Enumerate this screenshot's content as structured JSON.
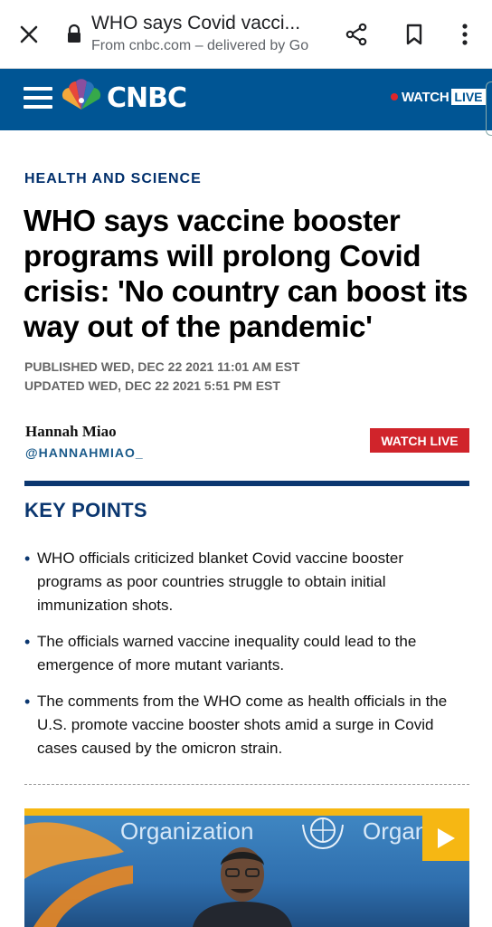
{
  "browser": {
    "title": "WHO says Covid vacci...",
    "subtitle": "From cnbc.com – delivered by Go"
  },
  "header": {
    "logo_text": "CNBC",
    "watch_label": "WATCH",
    "live_label": "LIVE"
  },
  "article": {
    "section": "HEALTH AND SCIENCE",
    "headline": "WHO says vaccine booster programs will prolong Covid crisis: 'No country can boost its way out of the pandemic'",
    "published": "PUBLISHED WED, DEC 22 2021 11:01 AM EST",
    "updated": "UPDATED WED, DEC 22 2021 5:51 PM EST",
    "author_name": "Hannah Miao",
    "author_handle": "@HANNAHMIAO_",
    "watch_live_button": "WATCH LIVE"
  },
  "key_points": {
    "title": "KEY POINTS",
    "items": [
      "WHO officials criticized blanket Covid vaccine booster programs as poor countries struggle to obtain initial immunization shots.",
      "The officials warned vaccine inequality could lead to the emergence of more mutant variants.",
      "The comments from the WHO come as health officials in the U.S. promote vaccine booster shots amid a surge in Covid cases caused by the omicron strain."
    ]
  },
  "video": {
    "backdrop_left": "Organization",
    "backdrop_right": "Organ"
  },
  "colors": {
    "brand_blue": "#005594",
    "navy": "#0b3770",
    "live_red": "#d0242b",
    "video_accent": "#f6b713"
  }
}
